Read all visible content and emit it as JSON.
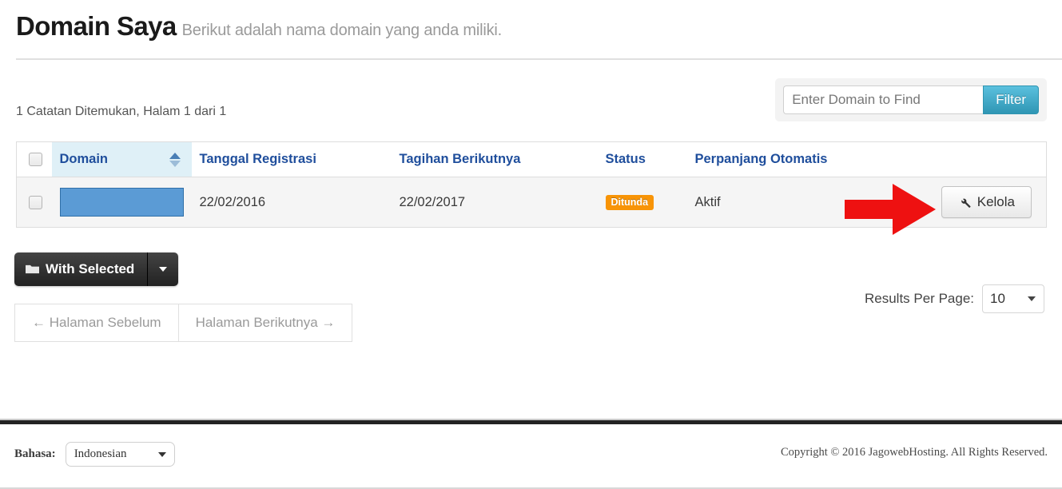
{
  "header": {
    "title": "Domain Saya",
    "subtitle": "Berikut adalah nama domain yang anda miliki."
  },
  "filter": {
    "placeholder": "Enter Domain to Find",
    "value": "",
    "button_label": "Filter"
  },
  "records_summary": "1 Catatan Ditemukan, Halam 1 dari 1",
  "table": {
    "columns": [
      {
        "label": "",
        "name": "select-all"
      },
      {
        "label": "Domain",
        "name": "domain",
        "sorted": true
      },
      {
        "label": "Tanggal Registrasi",
        "name": "registration-date"
      },
      {
        "label": "Tagihan Berikutnya",
        "name": "next-due-date"
      },
      {
        "label": "Status",
        "name": "status"
      },
      {
        "label": "Perpanjang Otomatis",
        "name": "auto-renew"
      },
      {
        "label": "",
        "name": "actions"
      }
    ],
    "rows": [
      {
        "domain": "",
        "registration_date": "22/02/2016",
        "next_due_date": "22/02/2017",
        "status_badge": "Ditunda",
        "auto_renew": "Aktif",
        "action_label": "Kelola"
      }
    ]
  },
  "with_selected": {
    "label": "With Selected",
    "icon": "folder-icon",
    "caret": "chevron-down-icon"
  },
  "pagination": {
    "previous": "← Halaman Sebelum",
    "next": "Halaman Berikutnya →"
  },
  "results_per_page": {
    "label": "Results Per Page:",
    "value": "10"
  },
  "footer": {
    "language_label": "Bahasa:",
    "language_value": "Indonesian",
    "copyright": "Copyright © 2016 JagowebHosting. All Rights Reserved."
  },
  "annotation": {
    "type": "red-arrow",
    "points_to": "Kelola",
    "color": "#ee1111"
  },
  "colors": {
    "accent_blue": "#2f96b4",
    "header_text_blue": "#1f4e9c",
    "sorted_col_bg": "#dff0f7",
    "badge_orange": "#f89406",
    "redaction_blue": "#5b9bd5",
    "dark_button": "#222222"
  }
}
